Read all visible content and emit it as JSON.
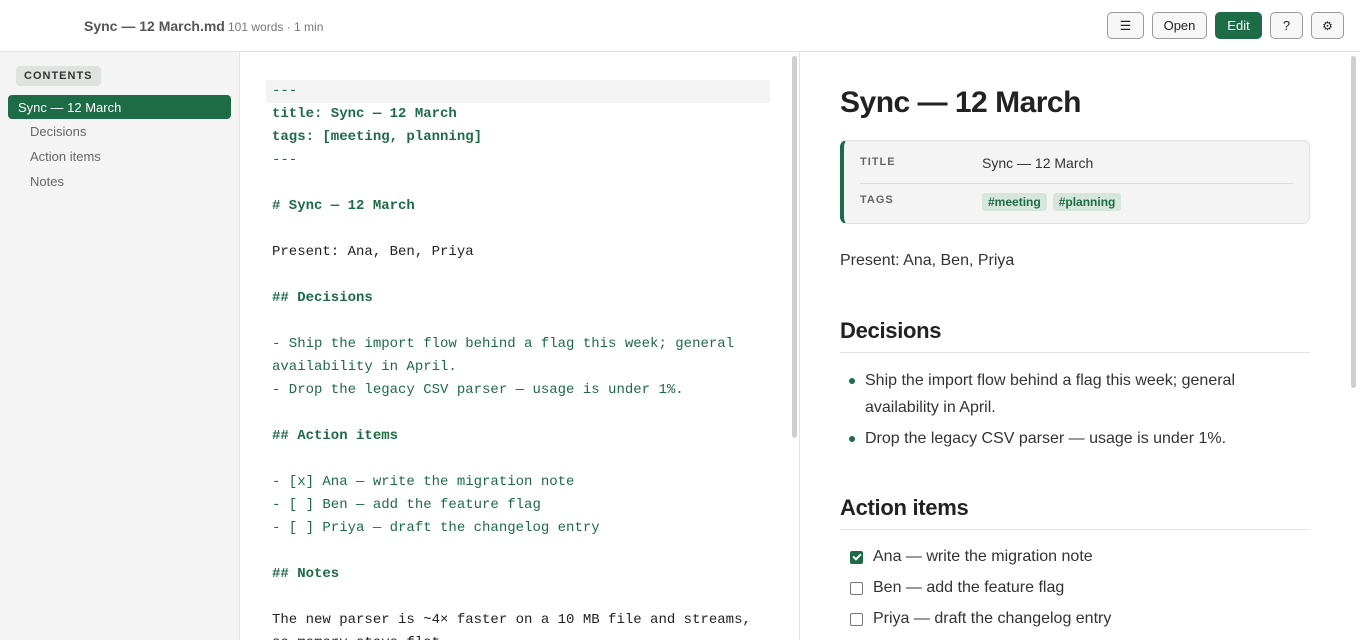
{
  "header": {
    "file_name": "Sync — 12 March.md",
    "file_meta": "101 words · 1 min",
    "menu_icon": "☰",
    "open_label": "Open",
    "edit_label": "Edit",
    "help_label": "?",
    "settings_icon": "⚙"
  },
  "sidebar": {
    "heading": "CONTENTS",
    "items": [
      {
        "label": "Sync — 12 March",
        "active": true
      },
      {
        "label": "Decisions"
      },
      {
        "label": "Action items"
      },
      {
        "label": "Notes"
      }
    ]
  },
  "editor": {
    "lines": [
      "---",
      "title: Sync — 12 March",
      "tags: [meeting, planning]",
      "---",
      "",
      "# Sync — 12 March",
      "",
      "Present: Ana, Ben, Priya",
      "",
      "## Decisions",
      "",
      "- Ship the import flow behind a flag this week; general",
      "availability in April.",
      "- Drop the legacy CSV parser — usage is under 1%.",
      "",
      "## Action items",
      "",
      "- [x] Ana — write the migration note",
      "- [ ] Ben — add the feature flag",
      "- [ ] Priya — draft the changelog entry",
      "",
      "## Notes",
      "",
      "The new parser is ~4× faster on a 10 MB file and streams,",
      "so memory stays flat."
    ]
  },
  "preview": {
    "title": "Sync — 12 March",
    "frontmatter": {
      "title_key": "TITLE",
      "title_value": "Sync — 12 March",
      "tags_key": "TAGS",
      "tags": [
        "#meeting",
        "#planning"
      ]
    },
    "present": "Present: Ana, Ben, Priya",
    "decisions_heading": "Decisions",
    "decisions": [
      "Ship the import flow behind a flag this week; general availability in April.",
      "Drop the legacy CSV parser — usage is under 1%."
    ],
    "actions_heading": "Action items",
    "tasks": [
      {
        "label": "Ana — write the migration note",
        "done": true
      },
      {
        "label": "Ben — add the feature flag",
        "done": false
      },
      {
        "label": "Priya — draft the changelog entry",
        "done": false
      }
    ]
  }
}
